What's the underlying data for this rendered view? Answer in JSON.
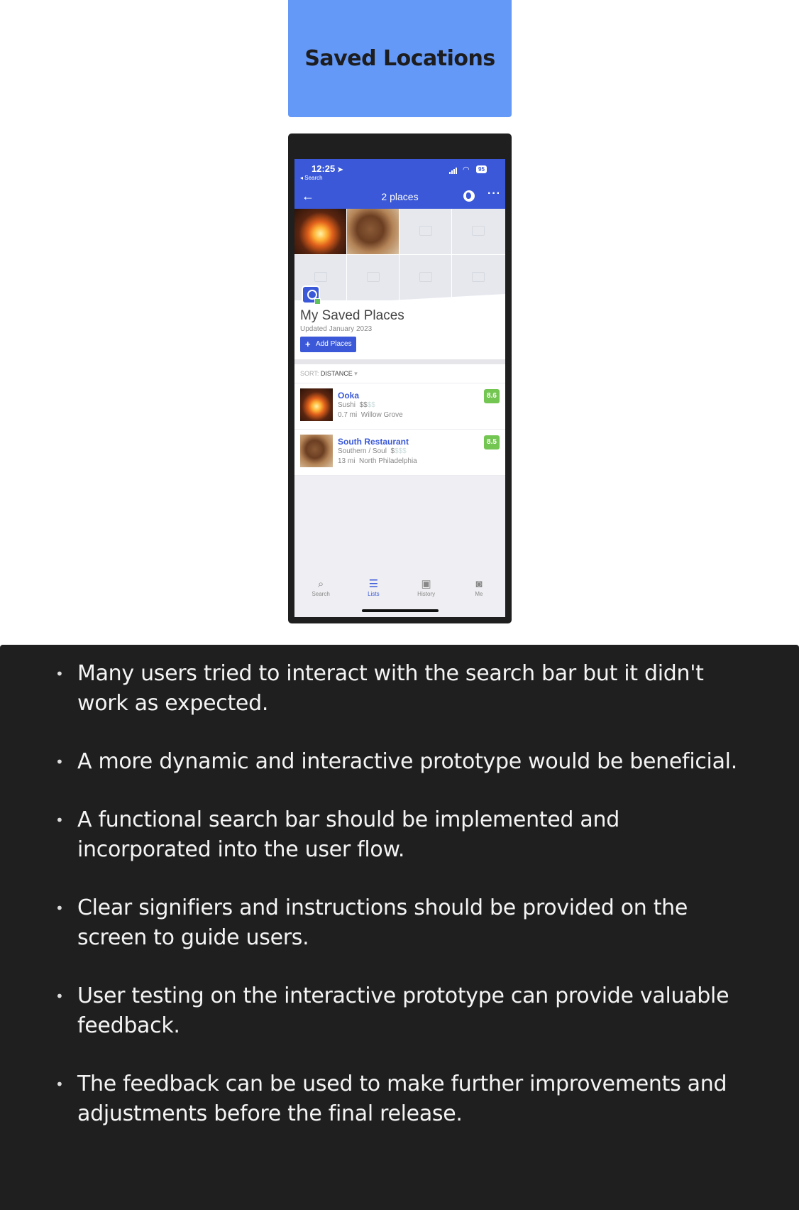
{
  "title_card": {
    "title": "Saved Locations"
  },
  "phone": {
    "status": {
      "time": "12:25",
      "back_app": "◂ Search",
      "battery": "95"
    },
    "navbar": {
      "title": "2 places"
    },
    "profile": {
      "name": "My Saved Places",
      "updated": "Updated January 2023",
      "add_button": "Add Places"
    },
    "sort": {
      "label": "SORT:",
      "value": "DISTANCE"
    },
    "places": [
      {
        "name": "Ooka",
        "category": "Sushi",
        "price": "$$",
        "price_faded": "$$",
        "distance": "0.7 mi",
        "area": "Willow Grove",
        "rating": "8.6"
      },
      {
        "name": "South Restaurant",
        "category": "Southern / Soul",
        "price": "$",
        "price_faded": "$$$",
        "distance": "13 mi",
        "area": "North Philadelphia",
        "rating": "8.5"
      }
    ],
    "tabs": [
      {
        "label": "Search",
        "icon": "search-icon"
      },
      {
        "label": "Lists",
        "icon": "list-icon"
      },
      {
        "label": "History",
        "icon": "history-icon"
      },
      {
        "label": "Me",
        "icon": "profile-icon"
      }
    ],
    "colors": {
      "brand_blue": "#3a58d8",
      "rating_green": "#74c653",
      "title_card_blue": "#6499f7"
    }
  },
  "feedback": {
    "items": [
      "Many users tried to interact with the search bar but it didn't work as expected.",
      "A more dynamic and interactive prototype would be beneficial.",
      "A functional search bar should be implemented and incorporated into the user flow.",
      "Clear signifiers and instructions should be provided on the screen to guide users.",
      "User testing on the interactive prototype can provide valuable feedback.",
      "The feedback can be used to make further improvements and adjustments before the final release."
    ]
  }
}
